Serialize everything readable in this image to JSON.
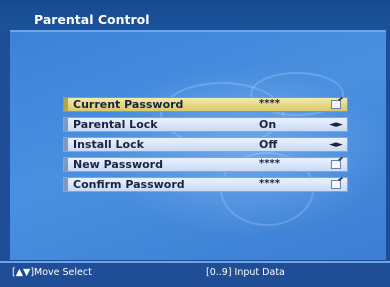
{
  "title": "Parental Control",
  "menu": {
    "items": [
      {
        "label": "Current Password",
        "value": "****",
        "control": "pencil-icon",
        "selected": true
      },
      {
        "label": "Parental Lock",
        "value": "On",
        "control": "left-right-arrows-icon",
        "selected": false
      },
      {
        "label": "Install Lock",
        "value": "Off",
        "control": "left-right-arrows-icon",
        "selected": false
      },
      {
        "label": "New Password",
        "value": "****",
        "control": "pencil-icon",
        "selected": false
      },
      {
        "label": "Confirm Password",
        "value": "****",
        "control": "pencil-icon",
        "selected": false
      }
    ]
  },
  "status": {
    "left": "[▲▼]Move Select",
    "right": "[0..9] Input Data"
  },
  "colors": {
    "background": "#1f4e97",
    "panel": "#4a90e0",
    "row": "#dce8fb",
    "row_selected": "#e6d98a"
  }
}
